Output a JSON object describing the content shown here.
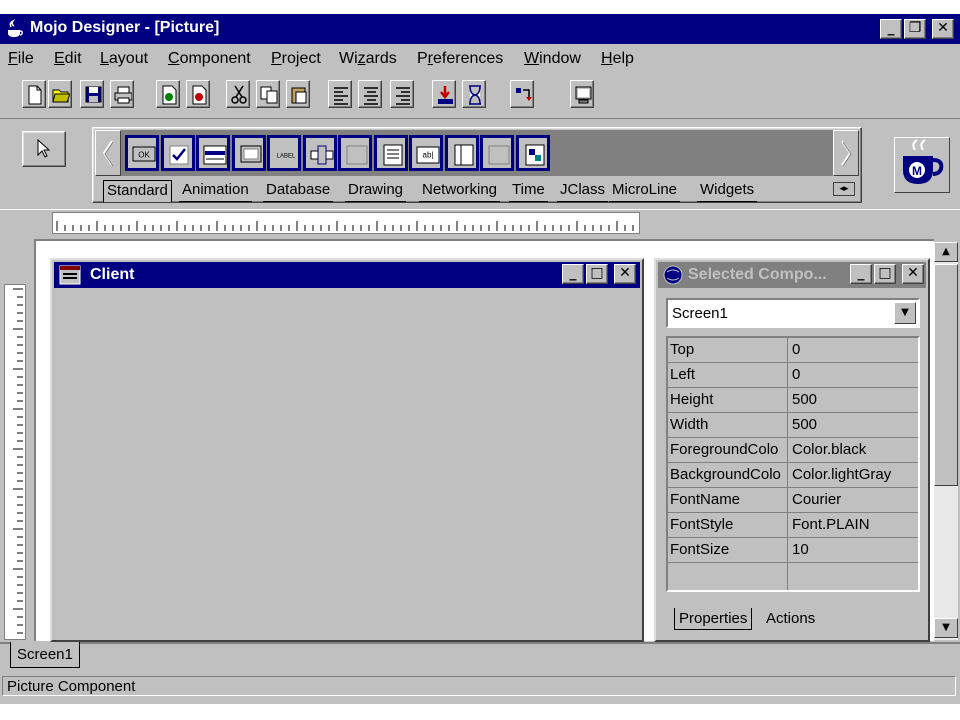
{
  "window": {
    "title": "Mojo Designer - [Picture]",
    "controls": {
      "minimize": "_",
      "restore": "❐",
      "close": "✕"
    }
  },
  "menubar": {
    "items": [
      {
        "label": "File",
        "mnemonic": "F"
      },
      {
        "label": "Edit",
        "mnemonic": "E"
      },
      {
        "label": "Layout",
        "mnemonic": "L"
      },
      {
        "label": "Component",
        "mnemonic": "C"
      },
      {
        "label": "Project",
        "mnemonic": "P"
      },
      {
        "label": "Wizards",
        "mnemonic": "z"
      },
      {
        "label": "Preferences",
        "mnemonic": "r"
      },
      {
        "label": "Window",
        "mnemonic": "W"
      },
      {
        "label": "Help",
        "mnemonic": "H"
      }
    ]
  },
  "toolbar": {
    "buttons": [
      "new-file-icon",
      "open-folder-icon",
      "save-icon",
      "print-icon",
      "add-page-icon",
      "remove-page-icon",
      "cut-icon",
      "copy-icon",
      "paste-icon",
      "align-left-icon",
      "align-center-icon",
      "align-right-icon",
      "compile-icon",
      "hourglass-icon",
      "run-icon",
      "monitor-icon"
    ]
  },
  "palette": {
    "components": [
      {
        "icon": "button-icon",
        "text": "OK"
      },
      {
        "icon": "checkbox-icon",
        "text": ""
      },
      {
        "icon": "list-icon",
        "text": ""
      },
      {
        "icon": "panel-icon",
        "text": ""
      },
      {
        "icon": "label-icon",
        "text": "LABEL"
      },
      {
        "icon": "scrollbar-icon",
        "text": ""
      },
      {
        "icon": "blank-component-icon",
        "text": ""
      },
      {
        "icon": "textarea-icon",
        "text": ""
      },
      {
        "icon": "textfield-icon",
        "text": "ab|"
      },
      {
        "icon": "frame-icon",
        "text": ""
      },
      {
        "icon": "blank-component-icon",
        "text": ""
      },
      {
        "icon": "image-component-icon",
        "text": ""
      }
    ],
    "tabs": [
      "Standard",
      "Animation",
      "Database",
      "Drawing",
      "Networking",
      "Time",
      "JClass",
      "MicroLine",
      "Widgets"
    ],
    "active_tab": "Standard"
  },
  "client_window": {
    "title": "Client"
  },
  "selected_component": {
    "title": "Selected Compo...",
    "selected": "Screen1",
    "properties": [
      {
        "name": "Top",
        "value": "0"
      },
      {
        "name": "Left",
        "value": "0"
      },
      {
        "name": "Height",
        "value": "500"
      },
      {
        "name": "Width",
        "value": "500"
      },
      {
        "name": "ForegroundColo",
        "value": "Color.black"
      },
      {
        "name": "BackgroundColo",
        "value": "Color.lightGray"
      },
      {
        "name": "FontName",
        "value": "Courier"
      },
      {
        "name": "FontStyle",
        "value": "Font.PLAIN"
      },
      {
        "name": "FontSize",
        "value": "10"
      }
    ],
    "tabs": [
      "Properties",
      "Actions"
    ],
    "active_tab": "Properties"
  },
  "screen_tabs": [
    "Screen1"
  ],
  "status": {
    "text": "Picture Component"
  },
  "colors": {
    "titlebar_active": "#000080",
    "titlebar_inactive": "#808080",
    "face": "#c0c0c0"
  }
}
